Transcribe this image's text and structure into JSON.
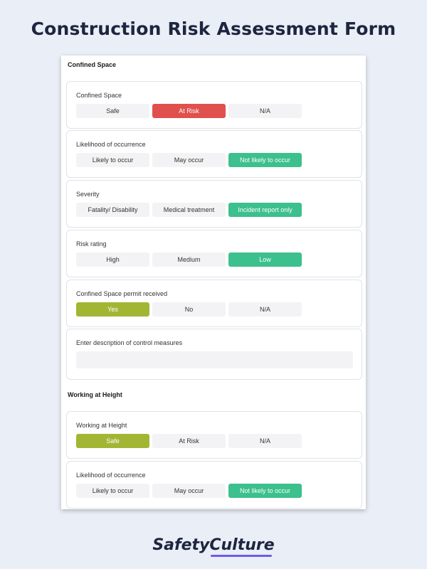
{
  "page": {
    "title": "Construction Risk Assessment Form"
  },
  "sections": {
    "confined": {
      "header": "Confined Space",
      "q1": {
        "label": "Confined Space",
        "options": [
          "Safe",
          "At Risk",
          "N/A"
        ],
        "selected": "At Risk"
      },
      "q2": {
        "label": "Likelihood of occurrence",
        "options": [
          "Likely to occur",
          "May occur",
          "Not likely to occur"
        ],
        "selected": "Not likely to occur"
      },
      "q3": {
        "label": "Severity",
        "options": [
          "Fatality/ Disability",
          "Medical treatment",
          "Incident report only"
        ],
        "selected": "Incident report only"
      },
      "q4": {
        "label": "Risk rating",
        "options": [
          "High",
          "Medium",
          "Low"
        ],
        "selected": "Low"
      },
      "q5": {
        "label": "Confined Space permit received",
        "options": [
          "Yes",
          "No",
          "N/A"
        ],
        "selected": "Yes"
      },
      "q6": {
        "label": "Enter description of control measures",
        "value": ""
      }
    },
    "height": {
      "header": "Working at Height",
      "q1": {
        "label": "Working at Height",
        "options": [
          "Safe",
          "At Risk",
          "N/A"
        ],
        "selected": "Safe"
      },
      "q2": {
        "label": "Likelihood of occurrence",
        "options": [
          "Likely to occur",
          "May occur",
          "Not likely to occur"
        ],
        "selected": "Not likely to occur"
      }
    }
  },
  "brand": {
    "name": "SafetyCulture"
  },
  "colors": {
    "at_risk": "#e0504d",
    "positive": "#3cc08d",
    "yes_safe": "#a2b634",
    "neutral": "#f3f3f5"
  }
}
